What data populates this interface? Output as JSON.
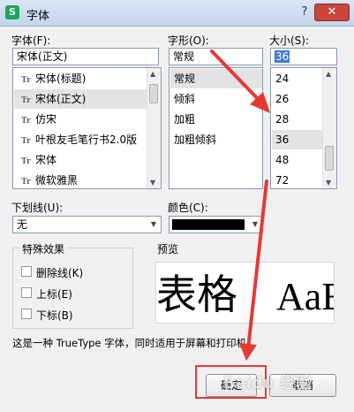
{
  "window": {
    "title": "字体",
    "app_icon": "S",
    "help": "?",
    "close": "✕"
  },
  "font": {
    "label": "字体(F):",
    "value": "宋体(正文)",
    "items": [
      {
        "name": "宋体(标题)"
      },
      {
        "name": "宋体(正文)",
        "selected": true
      },
      {
        "name": "仿宋"
      },
      {
        "name": "叶根友毛笔行书2.0版"
      },
      {
        "name": "宋体"
      },
      {
        "name": "微软雅黑"
      }
    ]
  },
  "style": {
    "label": "字形(O):",
    "value": "常规",
    "items": [
      {
        "name": "常规",
        "selected": true
      },
      {
        "name": "倾斜"
      },
      {
        "name": "加粗"
      },
      {
        "name": "加粗倾斜"
      }
    ]
  },
  "size": {
    "label": "大小(S):",
    "value": "36",
    "items": [
      {
        "name": "24"
      },
      {
        "name": "26"
      },
      {
        "name": "28"
      },
      {
        "name": "36",
        "selected": true
      },
      {
        "name": "48"
      },
      {
        "name": "72"
      }
    ]
  },
  "underline": {
    "label": "下划线(U):",
    "value": "无"
  },
  "color": {
    "label": "颜色(C):",
    "value": "#000000"
  },
  "effects": {
    "title": "特殊效果",
    "options": [
      {
        "label": "删除线(K)",
        "checked": false
      },
      {
        "label": "上标(E)",
        "checked": false
      },
      {
        "label": "下标(B)",
        "checked": false
      }
    ]
  },
  "preview": {
    "title": "预览",
    "text_cn": "表格",
    "text_en": "AaE"
  },
  "info": "这是一种 TrueType 字体，同时适用于屏幕和打印机。",
  "buttons": {
    "ok": "确定",
    "cancel": "取消"
  },
  "watermark": "Baidu 经验",
  "colors": {
    "highlight": "#e53935",
    "titlebar": "#c3d6ec",
    "close": "#c9463d"
  },
  "icons": {
    "font_item": "font-type-icon",
    "scroll_up": "▲",
    "scroll_down": "▼",
    "dropdown": "▼",
    "glyph": "Tr"
  }
}
